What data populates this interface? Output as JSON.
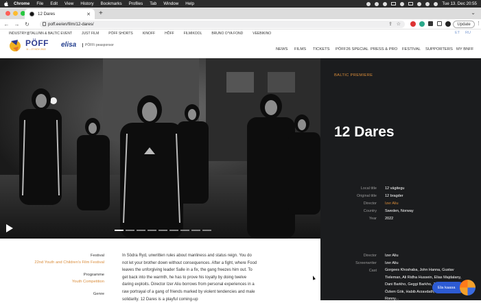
{
  "menubar": {
    "app_name": "Chrome",
    "items": [
      "File",
      "Edit",
      "View",
      "History",
      "Bookmarks",
      "Profiles",
      "Tab",
      "Window",
      "Help"
    ],
    "clock": "Tue 13. Dec  20:55"
  },
  "browser": {
    "tab_title": "12 Dares",
    "new_tab": "+",
    "url": "poff.ee/en/film/12-dares/",
    "update_label": "Update"
  },
  "site": {
    "toplinks": [
      "INDUSTRY@TALLINN & BALTIC EVENT",
      "JUST FILM",
      "PÖFF SHORTS",
      "KINOFF",
      "HÕFF",
      "FILMIKOOL",
      "BRUNO O'YA FOND",
      "VEEBIKINO"
    ],
    "languages": [
      "ET",
      "RU"
    ],
    "logo_text": "PÖFF",
    "logo_date": "11 – 27 NOV 2022",
    "sponsor_name": "elisa",
    "sponsor_tagline": "PÖFFi peasponsor",
    "nav": [
      "NEWS",
      "FILMS",
      "TICKETS",
      "PÖFF26 SPECIAL",
      "PRESS & PRO",
      "FESTIVAL",
      "SUPPORTERS",
      "MY BNFF"
    ]
  },
  "film": {
    "badge": "BALTIC PREMIERE",
    "title": "12 Dares",
    "meta": [
      {
        "key": "Local title",
        "value": "12 vägitegu",
        "accent": false
      },
      {
        "key": "Original title",
        "value": "12 bragder",
        "accent": false
      },
      {
        "key": "Director",
        "value": "Izer Aliu",
        "accent": true
      },
      {
        "key": "Country",
        "value": "Sweden, Norway",
        "accent": false
      },
      {
        "key": "Year",
        "value": "2022",
        "accent": false
      }
    ],
    "festival_label": "Festival",
    "festival_value": "22nd Youth and Children's Film Festival",
    "programme_label": "Programme",
    "programme_value": "Youth Competition",
    "genre_label": "Genre",
    "synopsis": "In Södra Ryd, unwritten rules about manliness and status reign. You do not let your brother down without consequences. After a fight, where Food leaves the unforgiving leader Salle in a fix, the gang freezes him out. To get back into the warmth, he has to prove his loyalty by doing twelve daring exploits. Director Izer Aliu borrows from personal experiences in a raw portrayal of a gang of friends marked by violent tendencies and male solidarity. 12 Dares is a playful coming-up",
    "credits": [
      {
        "key": "Director",
        "value": "Izer Aliu"
      },
      {
        "key": "Screenwriter",
        "value": "Izer Aliu"
      },
      {
        "key": "Cast",
        "value": "Gorgees Khoshaba, John Hanna, Gustav Tieleman, Ali Ridha Hussein, Elias Majdalany, Dani Barkho, Geggi Barkho, Johannes Dogan, Özlem Gök, Habib Arzavdath, Elsa Hassan, Ronny..."
      }
    ]
  },
  "chat": {
    "label": "Ela kaasa"
  }
}
